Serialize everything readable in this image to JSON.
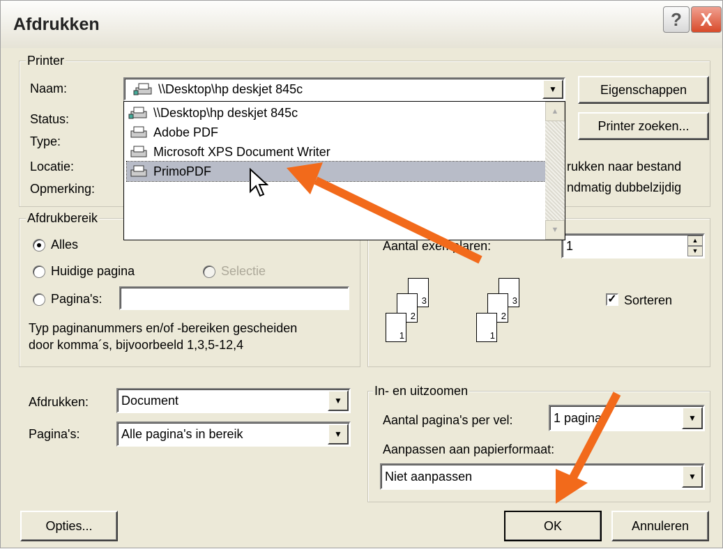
{
  "window": {
    "title": "Afdrukken",
    "help_icon": "?",
    "close_icon": "X"
  },
  "printer": {
    "group_label": "Printer",
    "name_label": "Naam:",
    "name_value": "\\\\Desktop\\hp deskjet 845c",
    "status_label": "Status:",
    "type_label": "Type:",
    "location_label": "Locatie:",
    "comment_label": "Opmerking:",
    "properties_button": "Eigenschappen",
    "find_printer_button": "Printer zoeken...",
    "print_to_file_text": "rukken naar bestand",
    "manual_duplex_text": "ndmatig dubbelzijdig",
    "dropdown_items": [
      "\\\\Desktop\\hp deskjet 845c",
      "Adobe PDF",
      "Microsoft XPS Document Writer",
      "PrimoPDF"
    ],
    "selected_item": "PrimoPDF"
  },
  "range": {
    "group_label": "Afdrukbereik",
    "all": "Alles",
    "current_page": "Huidige pagina",
    "selection": "Selectie",
    "pages": "Pagina's:",
    "pages_value": "",
    "hint_line1": "Typ paginanummers en/of -bereiken gescheiden",
    "hint_line2": "door komma´s, bijvoorbeeld 1,3,5-12,4"
  },
  "copies": {
    "label": "Aantal exemplaren:",
    "value": "1",
    "collate": "Sorteren",
    "collate_checked": true,
    "page_numbers": [
      "1",
      "2",
      "3"
    ]
  },
  "print_what": {
    "label": "Afdrukken:",
    "value": "Document"
  },
  "print_pages": {
    "label": "Pagina's:",
    "value": "Alle pagina's in bereik"
  },
  "zoom": {
    "group_label": "In- en uitzoomen",
    "per_sheet_label": "Aantal pagina's per vel:",
    "per_sheet_value": "1 pagina",
    "scale_label": "Aanpassen aan papierformaat:",
    "scale_value": "Niet aanpassen"
  },
  "buttons": {
    "options": "Opties...",
    "ok": "OK",
    "cancel": "Annuleren"
  },
  "colors": {
    "arrow": "#f26a1b",
    "selection": "#b8bcc8",
    "dialog_bg": "#ece9d8"
  }
}
